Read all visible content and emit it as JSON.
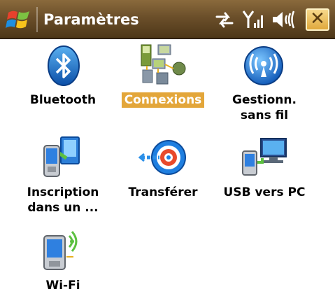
{
  "titlebar": {
    "title": "Paramètres",
    "close_glyph": "✕",
    "icons": [
      "windows-start-icon",
      "network-sync-icon",
      "signal-strength-icon",
      "volume-icon",
      "close-icon"
    ]
  },
  "colors": {
    "titlebar_gradient_top": "#8a6a3c",
    "titlebar_gradient_bottom": "#4e3718",
    "selection": "#e3a63a",
    "label_text": "#000000"
  },
  "items": [
    {
      "label": "Bluetooth",
      "icon": "bluetooth-icon",
      "selected": false
    },
    {
      "label": "Connexions",
      "icon": "connections-icon",
      "selected": true
    },
    {
      "line1": "Gestionn.",
      "line2": "sans fil",
      "icon": "wireless-manager-icon",
      "selected": false
    },
    {
      "line1": "Inscription",
      "line2": "dans un ...",
      "icon": "domain-enroll-icon",
      "selected": false
    },
    {
      "label": "Transférer",
      "icon": "beam-transfer-icon",
      "selected": false
    },
    {
      "label": "USB vers PC",
      "icon": "usb-to-pc-icon",
      "selected": false
    },
    {
      "label": "Wi-Fi",
      "icon": "wifi-icon",
      "selected": false
    }
  ]
}
